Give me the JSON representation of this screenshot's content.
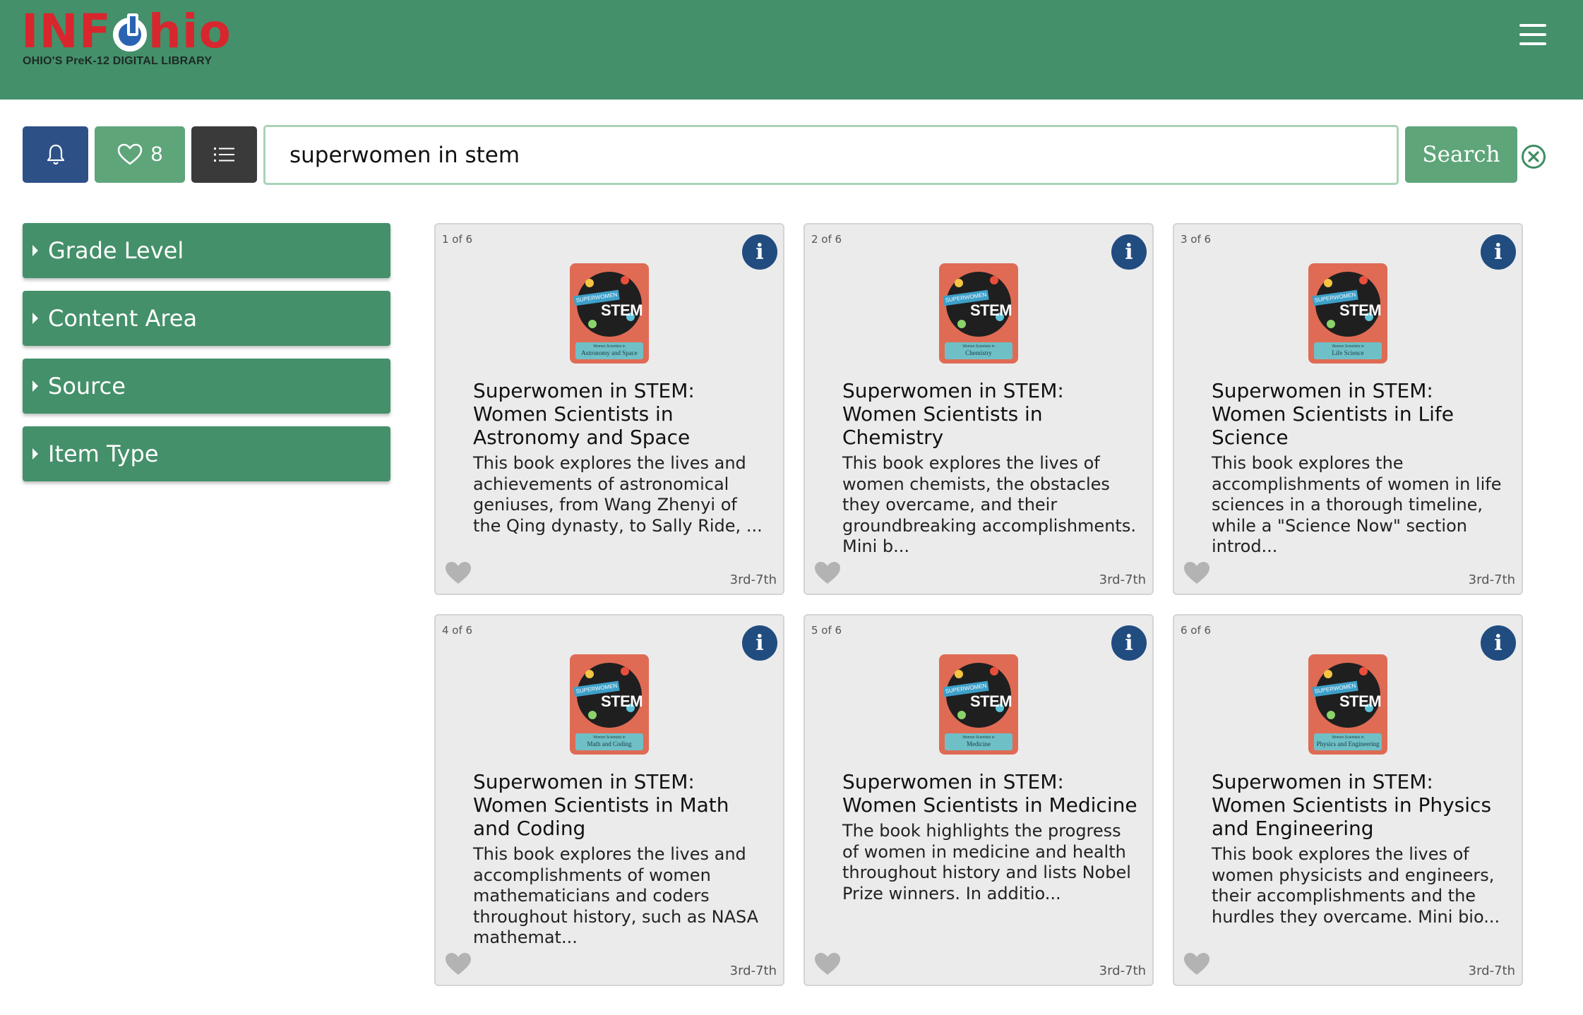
{
  "header": {
    "logo_text": "INFOhio",
    "logo_tagline": "OHIO'S PreK-12 DIGITAL LIBRARY"
  },
  "toolbar": {
    "favorites_count": "8",
    "search_value": "superwomen in stem",
    "search_label": "Search"
  },
  "facets": [
    "Grade Level",
    "Content Area",
    "Source",
    "Item Type"
  ],
  "colors": {
    "header_bg": "#44906a",
    "facet_bg": "#44906a",
    "notify_btn": "#2d5187",
    "list_btn": "#3a3a3a",
    "accent_green": "#5ea57a",
    "info_badge": "#214c80",
    "cover_red": "#df6b55"
  },
  "icons": {
    "notify": "bell-icon",
    "favorites": "heart-outline-icon",
    "list": "list-icon",
    "clear": "circle-x-icon",
    "info": "info-icon",
    "favorite_item": "heart-icon",
    "menu": "hamburger-icon"
  },
  "results": [
    {
      "count": "1 of 6",
      "title": "Superwomen in STEM: Women Scientists in Astronomy and Space",
      "description": "This book explores the lives and achievements of astronomical geniuses, from Wang Zhenyi of the Qing dynasty, to Sally Ride, ...",
      "grade": "3rd-7th",
      "cover": {
        "ribbon": "SUPERWOMEN",
        "stem": "STEM",
        "subtitle": "Women Scientists in",
        "topic": "Astronomy and Space"
      }
    },
    {
      "count": "2 of 6",
      "title": "Superwomen in STEM: Women Scientists in Chemistry",
      "description": "This book explores the lives of women chemists, the obstacles they overcame, and their groundbreaking accomplishments. Mini b...",
      "grade": "3rd-7th",
      "cover": {
        "ribbon": "SUPERWOMEN",
        "stem": "STEM",
        "subtitle": "Women Scientists in",
        "topic": "Chemistry"
      }
    },
    {
      "count": "3 of 6",
      "title": "Superwomen in STEM: Women Scientists in Life Science",
      "description": "This book explores the accomplishments of women in life sciences in a thorough timeline, while a \"Science Now\" section introd...",
      "grade": "3rd-7th",
      "cover": {
        "ribbon": "SUPERWOMEN",
        "stem": "STEM",
        "subtitle": "Women Scientists in",
        "topic": "Life Science"
      }
    },
    {
      "count": "4 of 6",
      "title": "Superwomen in STEM: Women Scientists in Math and Coding",
      "description": "This book explores the lives and accomplishments of women mathematicians and coders throughout history, such as NASA mathemat...",
      "grade": "3rd-7th",
      "cover": {
        "ribbon": "SUPERWOMEN",
        "stem": "STEM",
        "subtitle": "Women Scientists in",
        "topic": "Math and Coding"
      }
    },
    {
      "count": "5 of 6",
      "title": "Superwomen in STEM: Women Scientists in Medicine",
      "description": "The book highlights the progress of women in medicine and health throughout history and lists Nobel Prize winners. In additio...",
      "grade": "3rd-7th",
      "cover": {
        "ribbon": "SUPERWOMEN",
        "stem": "STEM",
        "subtitle": "Women Scientists in",
        "topic": "Medicine"
      }
    },
    {
      "count": "6 of 6",
      "title": "Superwomen in STEM: Women Scientists in Physics and Engineering",
      "description": "This book explores the lives of women physicists and engineers, their accomplishments and the hurdles they overcame. Mini bio...",
      "grade": "3rd-7th",
      "cover": {
        "ribbon": "SUPERWOMEN",
        "stem": "STEM",
        "subtitle": "Women Scientists in",
        "topic": "Physics and Engineering"
      }
    }
  ]
}
